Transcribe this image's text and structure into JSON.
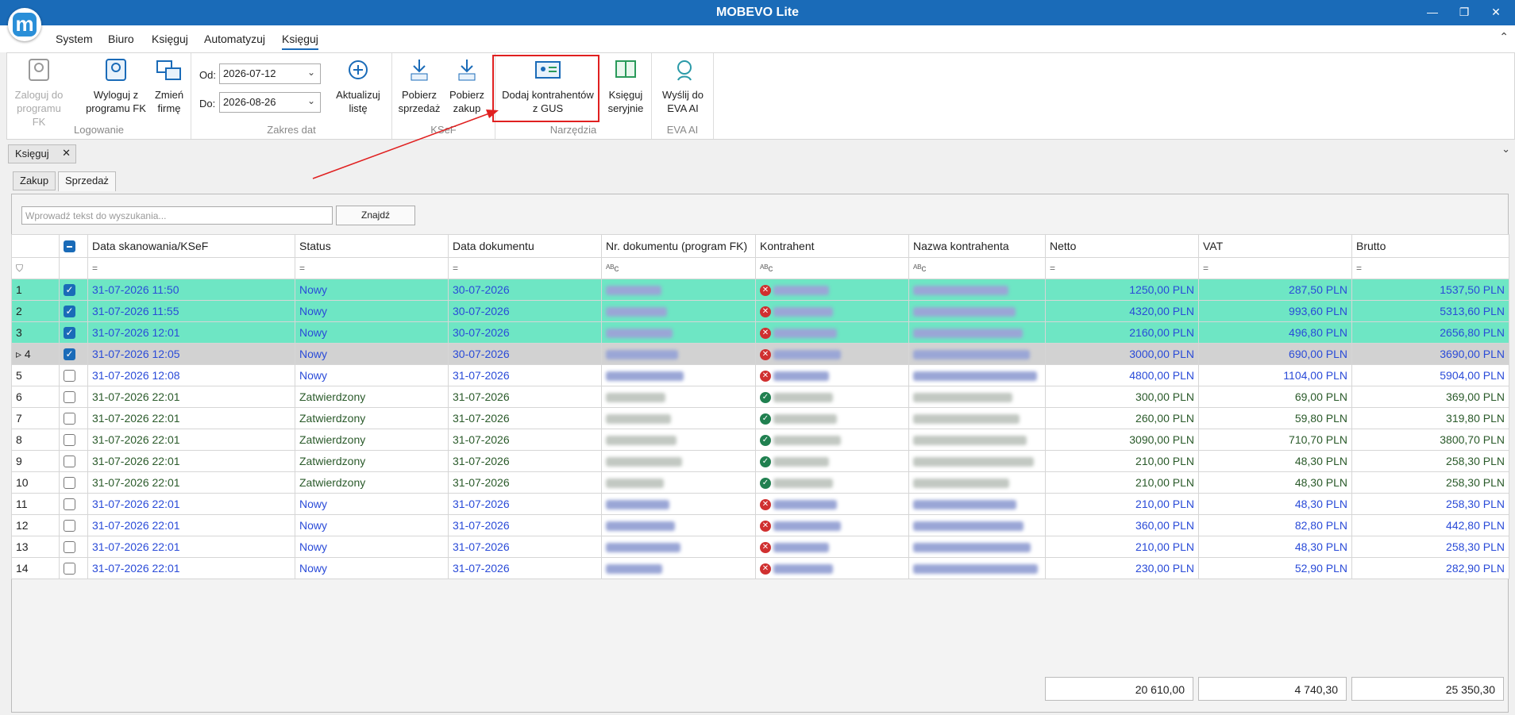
{
  "app": {
    "title": "MOBEVO Lite",
    "logo_letter": "m"
  },
  "window": {
    "minimize": "—",
    "restore": "❐",
    "close": "✕"
  },
  "menu": [
    "System",
    "Biuro",
    "Księguj",
    "Automatyzuj",
    "Księguj"
  ],
  "ribbon": {
    "logowanie": {
      "label": "Logowanie",
      "zaloguj": [
        "Zaloguj do",
        "programu FK"
      ],
      "wyloguj": [
        "Wyloguj z",
        "programu FK"
      ],
      "zmien": [
        "Zmień",
        "firmę"
      ]
    },
    "zakres": {
      "label": "Zakres dat",
      "od_label": "Od:",
      "od": "2026-07-12",
      "do_label": "Do:",
      "do": "2026-08-26",
      "aktualizuj": [
        "Aktualizuj",
        "listę"
      ]
    },
    "ksef": {
      "label": "KSeF",
      "sprzedaz": [
        "Pobierz",
        "sprzedaż"
      ],
      "zakup": [
        "Pobierz",
        "zakup"
      ]
    },
    "narzedzia": {
      "label": "Narzędzia",
      "dodaj": [
        "Dodaj kontrahentów",
        "z GUS"
      ],
      "seryjnie": [
        "Księguj",
        "seryjnie"
      ]
    },
    "eva": {
      "label": "EVA AI",
      "wyslij": [
        "Wyślij do",
        "EVA AI"
      ]
    }
  },
  "doc_tab": "Księguj",
  "subtabs": [
    "Zakup",
    "Sprzedaż"
  ],
  "search": {
    "placeholder": "Wprowadź tekst do wyszukania...",
    "button": "Znajdź"
  },
  "columns": [
    "Data skanowania/KSeF",
    "Status",
    "Data dokumentu",
    "Nr. dokumentu (program FK)",
    "Kontrahent",
    "Nazwa kontrahenta",
    "Netto",
    "VAT",
    "Brutto"
  ],
  "rows": [
    {
      "n": "1",
      "check": true,
      "scan": "31-07-2026 11:50",
      "status": "Nowy",
      "date": "30-07-2026",
      "ok": false,
      "netto": "1250,00 PLN",
      "vat": "287,50 PLN",
      "brutto": "1537,50 PLN"
    },
    {
      "n": "2",
      "check": true,
      "scan": "31-07-2026 11:55",
      "status": "Nowy",
      "date": "30-07-2026",
      "ok": false,
      "netto": "4320,00 PLN",
      "vat": "993,60 PLN",
      "brutto": "5313,60 PLN"
    },
    {
      "n": "3",
      "check": true,
      "scan": "31-07-2026 12:01",
      "status": "Nowy",
      "date": "30-07-2026",
      "ok": false,
      "netto": "2160,00 PLN",
      "vat": "496,80 PLN",
      "brutto": "2656,80 PLN"
    },
    {
      "n": "4",
      "check": true,
      "scan": "31-07-2026 12:05",
      "status": "Nowy",
      "date": "30-07-2026",
      "ok": false,
      "netto": "3000,00 PLN",
      "vat": "690,00 PLN",
      "brutto": "3690,00 PLN"
    },
    {
      "n": "5",
      "check": false,
      "scan": "31-07-2026 12:08",
      "status": "Nowy",
      "date": "31-07-2026",
      "ok": false,
      "netto": "4800,00 PLN",
      "vat": "1104,00 PLN",
      "brutto": "5904,00 PLN"
    },
    {
      "n": "6",
      "check": false,
      "scan": "31-07-2026 22:01",
      "status": "Zatwierdzony",
      "date": "31-07-2026",
      "ok": true,
      "netto": "300,00 PLN",
      "vat": "69,00 PLN",
      "brutto": "369,00 PLN"
    },
    {
      "n": "7",
      "check": false,
      "scan": "31-07-2026 22:01",
      "status": "Zatwierdzony",
      "date": "31-07-2026",
      "ok": true,
      "netto": "260,00 PLN",
      "vat": "59,80 PLN",
      "brutto": "319,80 PLN"
    },
    {
      "n": "8",
      "check": false,
      "scan": "31-07-2026 22:01",
      "status": "Zatwierdzony",
      "date": "31-07-2026",
      "ok": true,
      "netto": "3090,00 PLN",
      "vat": "710,70 PLN",
      "brutto": "3800,70 PLN"
    },
    {
      "n": "9",
      "check": false,
      "scan": "31-07-2026 22:01",
      "status": "Zatwierdzony",
      "date": "31-07-2026",
      "ok": true,
      "netto": "210,00 PLN",
      "vat": "48,30 PLN",
      "brutto": "258,30 PLN"
    },
    {
      "n": "10",
      "check": false,
      "scan": "31-07-2026 22:01",
      "status": "Zatwierdzony",
      "date": "31-07-2026",
      "ok": true,
      "netto": "210,00 PLN",
      "vat": "48,30 PLN",
      "brutto": "258,30 PLN"
    },
    {
      "n": "11",
      "check": false,
      "scan": "31-07-2026 22:01",
      "status": "Nowy",
      "date": "31-07-2026",
      "ok": false,
      "netto": "210,00 PLN",
      "vat": "48,30 PLN",
      "brutto": "258,30 PLN"
    },
    {
      "n": "12",
      "check": false,
      "scan": "31-07-2026 22:01",
      "status": "Nowy",
      "date": "31-07-2026",
      "ok": false,
      "netto": "360,00 PLN",
      "vat": "82,80 PLN",
      "brutto": "442,80 PLN"
    },
    {
      "n": "13",
      "check": false,
      "scan": "31-07-2026 22:01",
      "status": "Nowy",
      "date": "31-07-2026",
      "ok": false,
      "netto": "210,00 PLN",
      "vat": "48,30 PLN",
      "brutto": "258,30 PLN"
    },
    {
      "n": "14",
      "check": false,
      "scan": "31-07-2026 22:01",
      "status": "Nowy",
      "date": "31-07-2026",
      "ok": false,
      "netto": "230,00 PLN",
      "vat": "52,90 PLN",
      "brutto": "282,90 PLN"
    }
  ],
  "totals": {
    "netto": "20 610,00",
    "vat": "4 740,30",
    "brutto": "25 350,30"
  }
}
